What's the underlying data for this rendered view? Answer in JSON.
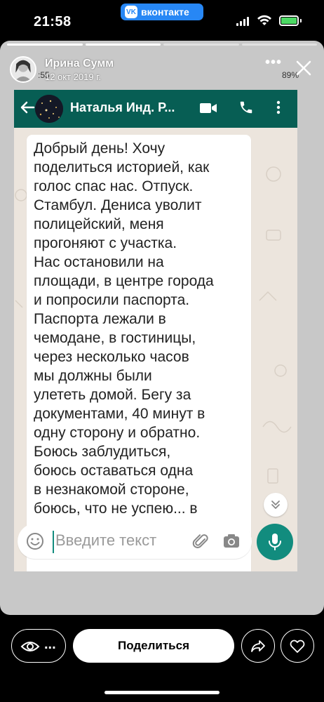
{
  "status_bar": {
    "time": "21:58",
    "app_pill": {
      "logo": "VK",
      "label": "вконтакте",
      "color": "#2787F5"
    },
    "battery_color": "#4CD964"
  },
  "story": {
    "progress_segments": 4,
    "progress_done": 2,
    "author": "Ирина Сумм",
    "date": "12 окт 2019 г.",
    "android_status": {
      "time": ":55",
      "battery": "89%"
    }
  },
  "whatsapp": {
    "header_color": "#075E54",
    "contact_name": "Наталья Инд. Р...",
    "message": "Добрый день! Хочу\nподелиться историей, как\nголос спас нас. Отпуск.\nСтамбул. Дениса уволит\nполицейский, меня\nпрогоняют с участка.\nНас остановили на\nплощади, в центре города\nи попросили паспорта.\nПаспорта лежали в\nчемодане, в гостиницы,\nчерез несколько часов\nмы должны были\nулететь домой. Бегу за\nдокументами, 40 минут в\nодну сторону и обратно.\nБоюсь заблудиться,\nбоюсь оставаться одна\nв незнакомой стороне,\nбоюсь, что не успею... в",
    "input_placeholder": "Введите текст",
    "accent_color": "#128C7E"
  },
  "bottom": {
    "views_label": "...",
    "share_label": "Поделиться"
  },
  "icons": [
    "vk-logo-icon",
    "signal-icon",
    "wifi-icon",
    "battery-icon",
    "close-icon",
    "more-icon",
    "back-arrow-icon",
    "video-call-icon",
    "phone-icon",
    "menu-icon",
    "chevron-down-icon",
    "emoji-icon",
    "attach-icon",
    "camera-icon",
    "mic-icon",
    "eye-icon",
    "forward-icon",
    "heart-icon"
  ]
}
